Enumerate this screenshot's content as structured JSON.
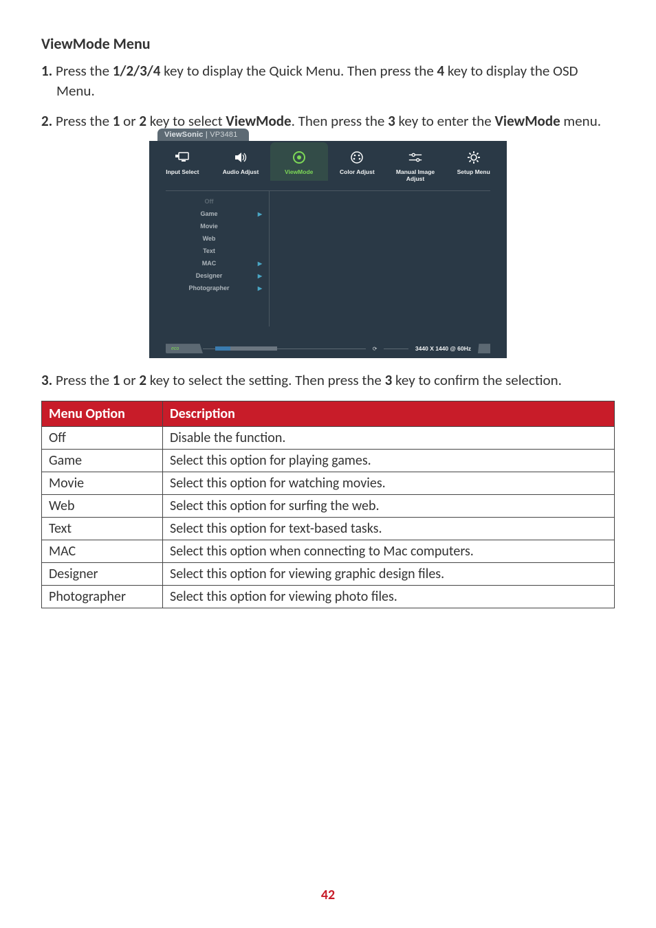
{
  "heading": "ViewMode Menu",
  "steps": {
    "s1_num": "1. ",
    "s1_a": "Press the ",
    "s1_b": "1/2/3/4",
    "s1_c": " key to display the Quick Menu. Then press the ",
    "s1_d": "4",
    "s1_e": " key to display the OSD Menu.",
    "s2_num": "2. ",
    "s2_a": "Press the ",
    "s2_b": "1",
    "s2_c": " or ",
    "s2_d": "2",
    "s2_e": " key to select ",
    "s2_f": "ViewMode",
    "s2_g": ". Then press the ",
    "s2_h": "3",
    "s2_i": " key to enter the ",
    "s2_j": "ViewMode",
    "s2_k": " menu.",
    "s3_num": "3. ",
    "s3_a": "Press the ",
    "s3_b": "1",
    "s3_c": " or ",
    "s3_d": "2",
    "s3_e": " key to select the setting. Then press the ",
    "s3_f": "3",
    "s3_g": " key to confirm the selection."
  },
  "osd": {
    "brand": "ViewSonic",
    "model": "VP3481",
    "tabs": {
      "input": "Input Select",
      "audio": "Audio Adjust",
      "viewmode": "ViewMode",
      "color": "Color Adjust",
      "manual": "Manual Image Adjust",
      "setup": "Setup Menu"
    },
    "list": {
      "off": "Off",
      "game": "Game",
      "movie": "Movie",
      "web": "Web",
      "text": "Text",
      "mac": "MAC",
      "designer": "Designer",
      "photographer": "Photographer"
    },
    "eco": "eco",
    "resolution": "3440 X 1440 @ 60Hz",
    "clock": "⟳"
  },
  "table": {
    "header_option": "Menu Option",
    "header_desc": "Description",
    "rows": [
      {
        "opt": "Off",
        "desc": "Disable the function."
      },
      {
        "opt": "Game",
        "desc": "Select this option for playing games."
      },
      {
        "opt": "Movie",
        "desc": "Select this option for watching movies."
      },
      {
        "opt": "Web",
        "desc": "Select this option for surfing the web."
      },
      {
        "opt": "Text",
        "desc": "Select this option for text-based tasks."
      },
      {
        "opt": "MAC",
        "desc": "Select this option when connecting to Mac computers."
      },
      {
        "opt": "Designer",
        "desc": "Select this option for viewing graphic design files."
      },
      {
        "opt": "Photographer",
        "desc": "Select this option for viewing photo files."
      }
    ]
  },
  "page_number": "42"
}
